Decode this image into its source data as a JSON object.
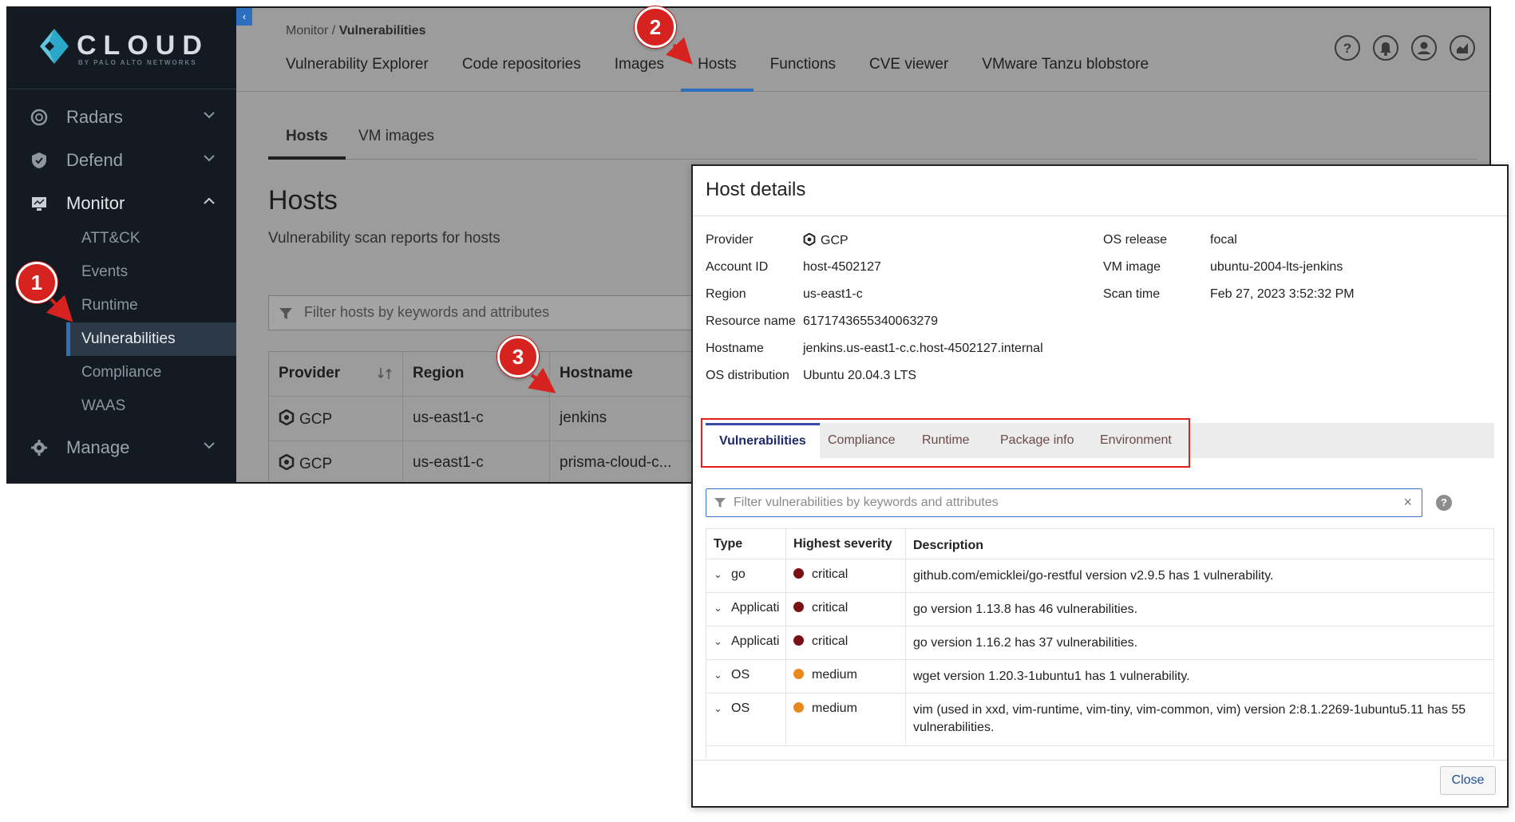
{
  "sidebar": {
    "logo_word": "CLOUD",
    "logo_sub": "BY PALO ALTO NETWORKS",
    "items": [
      {
        "label": "Radars",
        "icon": "radar-icon"
      },
      {
        "label": "Defend",
        "icon": "shield-icon"
      },
      {
        "label": "Monitor",
        "icon": "monitor-icon"
      },
      {
        "label": "Manage",
        "icon": "gear-icon"
      }
    ],
    "monitor_sub": [
      "ATT&CK",
      "Events",
      "Runtime",
      "Vulnerabilities",
      "Compliance",
      "WAAS"
    ]
  },
  "topbar": {
    "breadcrumb_parent": "Monitor",
    "breadcrumb_sep": " / ",
    "breadcrumb_current": "Vulnerabilities",
    "tabs": [
      "Vulnerability Explorer",
      "Code repositories",
      "Images",
      "Hosts",
      "Functions",
      "CVE viewer",
      "VMware Tanzu blobstore"
    ],
    "active_tab": "Hosts",
    "icons": [
      "help-icon",
      "bell-icon",
      "user-icon",
      "chart-icon"
    ]
  },
  "hosts_page": {
    "subtabs": [
      "Hosts",
      "VM images"
    ],
    "title": "Hosts",
    "subtitle": "Vulnerability scan reports for hosts",
    "filter_placeholder": "Filter hosts by keywords and attributes",
    "columns": [
      "Provider",
      "Region",
      "Hostname"
    ],
    "rows": [
      {
        "provider": "GCP",
        "region": "us-east1-c",
        "hostname": "jenkins"
      },
      {
        "provider": "GCP",
        "region": "us-east1-c",
        "hostname": "prisma-cloud-c..."
      }
    ]
  },
  "callouts": [
    "1",
    "2",
    "3"
  ],
  "modal": {
    "title": "Host details",
    "left_fields": [
      {
        "key": "Provider",
        "value": "GCP"
      },
      {
        "key": "Account ID",
        "value": "host-4502127"
      },
      {
        "key": "Region",
        "value": "us-east1-c"
      },
      {
        "key": "Resource name",
        "value": "6171743655340063279"
      },
      {
        "key": "Hostname",
        "value": "jenkins.us-east1-c.c.host-4502127.internal"
      },
      {
        "key": "OS distribution",
        "value": "Ubuntu 20.04.3 LTS"
      }
    ],
    "right_fields": [
      {
        "key": "OS release",
        "value": "focal"
      },
      {
        "key": "VM image",
        "value": "ubuntu-2004-lts-jenkins"
      },
      {
        "key": "Scan time",
        "value": "Feb 27, 2023 3:52:32 PM"
      }
    ],
    "tabs": [
      "Vulnerabilities",
      "Compliance",
      "Runtime",
      "Package info",
      "Environment"
    ],
    "active_tab": "Vulnerabilities",
    "filter_placeholder": "Filter vulnerabilities by keywords and attributes",
    "clear_symbol": "×",
    "help_symbol": "?",
    "columns": [
      "Type",
      "Highest severity",
      "Description"
    ],
    "rows": [
      {
        "type": "go",
        "severity": "critical",
        "description": "github.com/emicklei/go-restful version v2.9.5 has 1 vulnerability."
      },
      {
        "type": "Applicati",
        "severity": "critical",
        "description": "go version 1.13.8 has 46 vulnerabilities."
      },
      {
        "type": "Applicati",
        "severity": "critical",
        "description": "go version 1.16.2 has 37 vulnerabilities."
      },
      {
        "type": "OS",
        "severity": "medium",
        "description": "wget version 1.20.3-1ubuntu1 has 1 vulnerability."
      },
      {
        "type": "OS",
        "severity": "medium",
        "description": "vim (used in xxd, vim-runtime, vim-tiny, vim-common, vim) version 2:8.1.2269-1ubuntu5.11 has 55 vulnerabilities."
      }
    ],
    "close_label": "Close"
  },
  "colors": {
    "critical": "#7a0f14",
    "medium": "#e8891e",
    "accent": "#2d6fbf",
    "callout": "#d7231f"
  }
}
